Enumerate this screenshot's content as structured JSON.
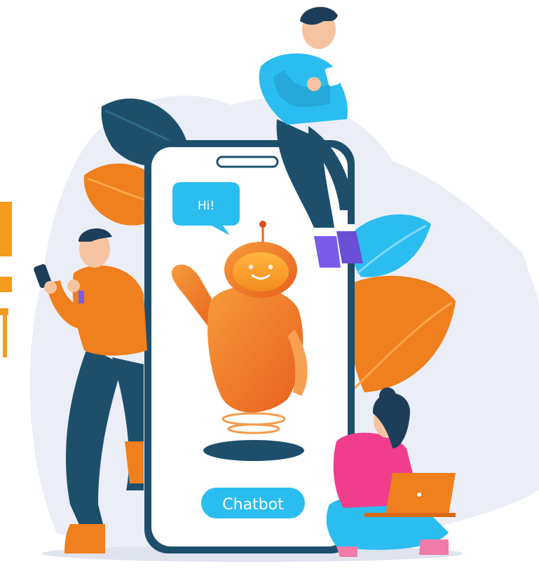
{
  "bubble": {
    "text": "Hi!"
  },
  "button": {
    "label": "Chatbot"
  },
  "colors": {
    "accent_blue": "#2bbdf0",
    "accent_orange": "#f07f1d",
    "navy": "#1d4f6c",
    "bg_blob": "#ebeef7"
  }
}
